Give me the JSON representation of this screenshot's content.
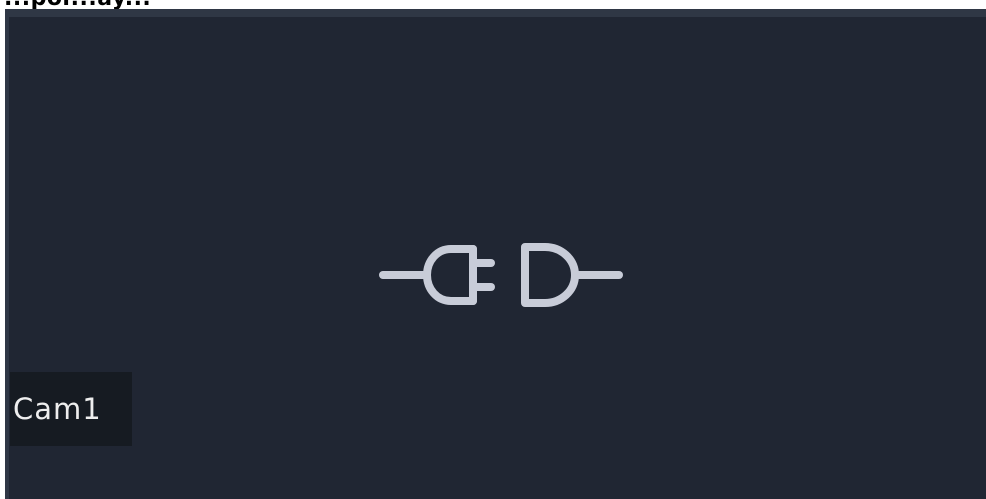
{
  "header": {
    "partial_text": "...por...ay..."
  },
  "camera_tile": {
    "label": "Cam1",
    "status_icon": "plug-disconnected-icon",
    "colors": {
      "frame": "#2f3745",
      "background": "#202633",
      "label_background": "#161b22",
      "icon": "#c8ccd8",
      "label_text": "#eeeeee"
    }
  }
}
